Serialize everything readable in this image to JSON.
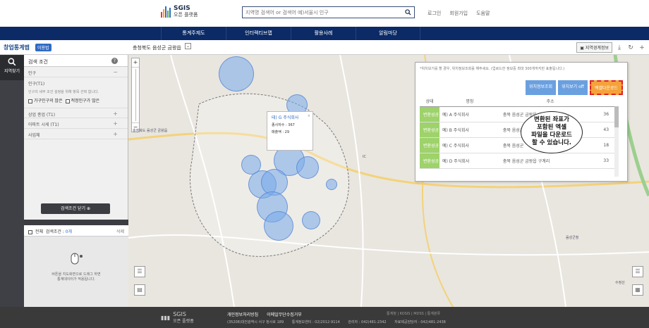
{
  "header": {
    "logo_title": "SGIS",
    "logo_subtitle": "오픈 플랫폼",
    "search_placeholder": "지역명 검색어 or 검색어 예)서울시 인구",
    "links": [
      "로그인",
      "회원가입",
      "도움말"
    ]
  },
  "nav": {
    "items": [
      "통계주제도",
      "인터랙티브맵",
      "활용사례",
      "알림마당"
    ]
  },
  "subbar": {
    "app_title": "창업통계맵",
    "badge": "이용법",
    "location": "충청북도 음성군 금왕읍",
    "boundary_button": "지역경계정보"
  },
  "sidebar": {
    "search_label": "지역찾기"
  },
  "panel": {
    "title": "검색 조건",
    "section_population": "인구",
    "sub_population": "인구(T1)",
    "population_desc": "인구의 세부 조건 설정을 위해 항목 선택 합니다.",
    "check_1": "가구인구의 많은",
    "check_2": "적정인구가 많은",
    "row_1": "상업 종업 (T1)",
    "row_2": "아파트 시세 (T1)",
    "row_3": "사업체",
    "close_button": "검색조건 닫기",
    "list_all": "전체",
    "list_label": "검색조건 :",
    "list_count": "0개",
    "list_delete": "삭제",
    "drag_hint_1": "버튼을 지도화면으로 드래그 하면",
    "drag_hint_2": "통계데이터가 적용됩니다."
  },
  "popup": {
    "name": "테) G 주식회사",
    "line1": "종사자수 : 367",
    "line2": "매출액 : 29"
  },
  "info_panel": {
    "notice": "*위치보기를 할 경우, 위치정보조회를 해주세요. (업로드한 정보중 최대 300개까지만 표출됩니다.)",
    "btn_lookup": "위치정보조회",
    "btn_view": "위치보기 off",
    "btn_download": "엑셀다운로드",
    "columns": [
      "상태",
      "명칭",
      "주소"
    ],
    "rows": [
      {
        "status": "변환성공",
        "name": "예) A 주식회사",
        "addr": "충북 음성군 금왕읍",
        "num": "36"
      },
      {
        "status": "변환성공",
        "name": "예) B 주식회사",
        "addr": "충북 음성군",
        "num": "43"
      },
      {
        "status": "변환성공",
        "name": "예) C 주식회사",
        "addr": "충북 음성군",
        "num": "18"
      },
      {
        "status": "변환성공",
        "name": "예) D 주식회사",
        "addr": "충북 음성군 금왕읍 구계리",
        "num": "33"
      }
    ]
  },
  "callout": {
    "line1": "변환된 좌표가",
    "line2": "포함된 엑셀",
    "line3": "파일을 다운로드",
    "line4": "할 수 있습니다."
  },
  "footer": {
    "logo_title": "SGIS",
    "logo_subtitle": "오픈 플랫폼",
    "link_privacy": "개인정보처리방침",
    "link_email": "이메일무단수집거부",
    "address": "(35208)대전광역시 서구 청사로 189",
    "phone_info": "통계정보센터 : 02)2012-9114",
    "phone_mgr": "관리자 : 042)481-2342",
    "phone_data": "자료제공담당자 : 042)481-2438",
    "right_links": "통계청 | KOSIS | MDSS | 통계분류"
  },
  "colors": {
    "nav_bg": "#0b2a66",
    "accent_blue": "#2f6bc2",
    "status_green": "#9ed26a",
    "download_orange": "#f5a23a"
  }
}
